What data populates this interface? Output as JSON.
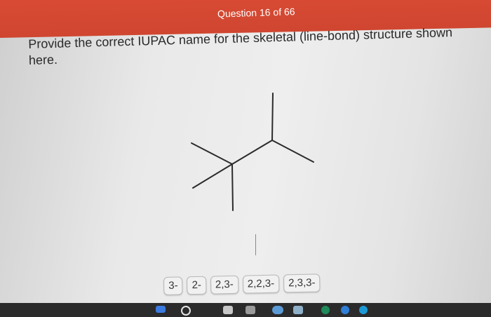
{
  "header": {
    "title": "Question 16 of 66"
  },
  "question": {
    "text": "Provide the correct IUPAC name for the skeletal (line-bond) structure shown here."
  },
  "choices": [
    "3-",
    "2-",
    "2,3-",
    "2,2,3-",
    "2,3,3-"
  ],
  "taskbar": {
    "icons": [
      "widgets-icon",
      "search-icon",
      "app-icon",
      "browser-icon",
      "chat-icon",
      "store-icon",
      "chrome-icon",
      "edge-icon"
    ]
  },
  "colors": {
    "header": "#d94a34",
    "header_text": "#ffffff",
    "body_text": "#2a2a2a",
    "chip_bg": "#f1f1f1",
    "taskbar": "#2b2b2b"
  }
}
